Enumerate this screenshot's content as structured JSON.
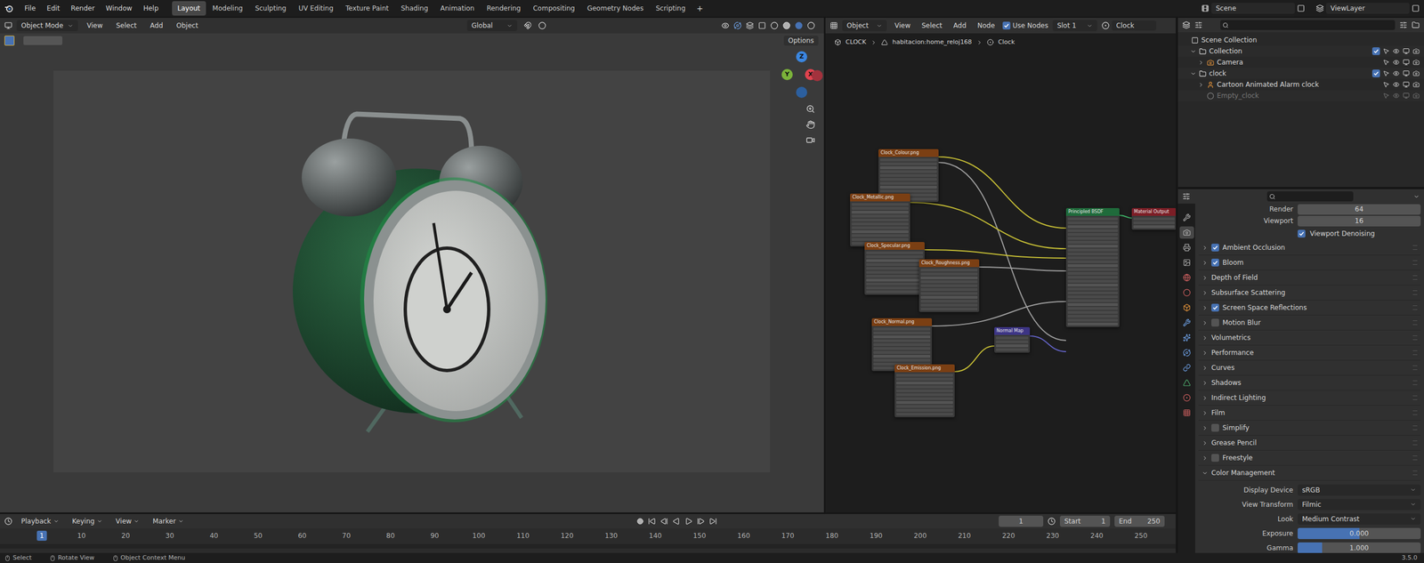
{
  "menu": [
    "File",
    "Edit",
    "Render",
    "Window",
    "Help"
  ],
  "workspaces": [
    {
      "label": "Layout",
      "selected": true
    },
    {
      "label": "Modeling",
      "selected": false
    },
    {
      "label": "Sculpting",
      "selected": false
    },
    {
      "label": "UV Editing",
      "selected": false
    },
    {
      "label": "Texture Paint",
      "selected": false
    },
    {
      "label": "Shading",
      "selected": false
    },
    {
      "label": "Animation",
      "selected": false
    },
    {
      "label": "Rendering",
      "selected": false
    },
    {
      "label": "Compositing",
      "selected": false
    },
    {
      "label": "Geometry Nodes",
      "selected": false
    },
    {
      "label": "Scripting",
      "selected": false
    }
  ],
  "add_workspace": "+",
  "scene": "Scene",
  "view_layer": "ViewLayer",
  "viewport": {
    "mode": "Object Mode",
    "menu": [
      "View",
      "Select",
      "Add",
      "Object"
    ],
    "orientation": "Global",
    "options": "Options",
    "gizmo": [
      {
        "label": "Z",
        "color": "#3b86e0"
      },
      {
        "label": "Y",
        "color": "#7bb33a"
      },
      {
        "label": "X",
        "color": "#e0434f"
      },
      {
        "label": "",
        "color": "#a3323d"
      },
      {
        "label": "",
        "color": "#2c5f9e"
      }
    ]
  },
  "node_editor": {
    "type": "Object",
    "menu": [
      "View",
      "Select",
      "Add",
      "Node"
    ],
    "use_nodes": {
      "label": "Use Nodes",
      "checked": true
    },
    "slot": "Slot 1",
    "material": "Clock",
    "breadcrumb": [
      "CLOCK",
      "habitacion:home_reloj168",
      "Clock"
    ],
    "nodes": [
      {
        "title": "Clock_Colour.png",
        "kind": "image"
      },
      {
        "title": "Clock_Metallic.png",
        "kind": "image"
      },
      {
        "title": "Clock_Specular.png",
        "kind": "image"
      },
      {
        "title": "Clock_Roughness.png",
        "kind": "image"
      },
      {
        "title": "Clock_Normal.png",
        "kind": "image"
      },
      {
        "title": "Clock_Emission.png",
        "kind": "image"
      },
      {
        "title": "Normal Map",
        "kind": "vector"
      },
      {
        "title": "Principled BSDF",
        "kind": "bsdf"
      },
      {
        "title": "Material Output",
        "kind": "output"
      }
    ]
  },
  "outliner": {
    "rows": [
      {
        "label": "Scene Collection",
        "kind": "scene",
        "depth": 0
      },
      {
        "label": "Collection",
        "kind": "collection",
        "depth": 1,
        "expanded": true,
        "checked": true
      },
      {
        "label": "Camera",
        "kind": "camera",
        "depth": 2,
        "expanded": false
      },
      {
        "label": "clock",
        "kind": "collection",
        "depth": 1,
        "expanded": true,
        "checked": true
      },
      {
        "label": "Cartoon Animated  Alarm clock",
        "kind": "armature",
        "depth": 2,
        "expanded": false
      },
      {
        "label": "Empty_clock",
        "kind": "empty",
        "depth": 2,
        "disabled": true
      }
    ]
  },
  "properties": {
    "tabs": [
      {
        "selected": false
      },
      {
        "selected": true
      },
      {
        "selected": false
      },
      {
        "selected": false
      },
      {
        "selected": false
      },
      {
        "selected": false
      },
      {
        "selected": false
      },
      {
        "selected": false
      },
      {
        "selected": false
      },
      {
        "selected": false
      },
      {
        "selected": false
      },
      {
        "selected": false
      },
      {
        "selected": false
      },
      {
        "selected": false
      }
    ],
    "samples": [
      {
        "label": "Render",
        "value": "64"
      },
      {
        "label": "Viewport",
        "value": "16"
      }
    ],
    "denoise": {
      "label": "Viewport Denoising",
      "checked": true
    },
    "panels": [
      {
        "label": "Ambient Occlusion",
        "kind": "toggle",
        "checked": true,
        "expanded": false
      },
      {
        "label": "Bloom",
        "kind": "toggle",
        "checked": true,
        "expanded": false
      },
      {
        "label": "Depth of Field",
        "kind": "plain",
        "expanded": false
      },
      {
        "label": "Subsurface Scattering",
        "kind": "plain",
        "expanded": false
      },
      {
        "label": "Screen Space Reflections",
        "kind": "toggle",
        "checked": true,
        "expanded": false
      },
      {
        "label": "Motion Blur",
        "kind": "toggle",
        "checked": false,
        "expanded": false
      },
      {
        "label": "Volumetrics",
        "kind": "plain",
        "expanded": false
      },
      {
        "label": "Performance",
        "kind": "plain",
        "expanded": false
      },
      {
        "label": "Curves",
        "kind": "plain",
        "expanded": false
      },
      {
        "label": "Shadows",
        "kind": "plain",
        "expanded": false
      },
      {
        "label": "Indirect Lighting",
        "kind": "plain",
        "expanded": false
      },
      {
        "label": "Film",
        "kind": "plain",
        "expanded": false
      },
      {
        "label": "Simplify",
        "kind": "toggle",
        "checked": false,
        "expanded": false
      },
      {
        "label": "Grease Pencil",
        "kind": "plain",
        "expanded": false
      },
      {
        "label": "Freestyle",
        "kind": "toggle",
        "checked": false,
        "expanded": false
      },
      {
        "label": "Color Management",
        "kind": "plain",
        "expanded": true
      }
    ],
    "color_management": [
      {
        "label": "Display Device",
        "value": "sRGB",
        "kind": "dropdown"
      },
      {
        "label": "View Transform",
        "value": "Filmic",
        "kind": "dropdown"
      },
      {
        "label": "Look",
        "value": "Medium Contrast",
        "kind": "dropdown"
      },
      {
        "label": "Exposure",
        "value": "0.000",
        "kind": "slider",
        "level": 0.5
      },
      {
        "label": "Gamma",
        "value": "1.000",
        "kind": "slider",
        "level": 0.2
      }
    ]
  },
  "timeline": {
    "menu": [
      "Playback",
      "Keying",
      "View",
      "Marker"
    ],
    "current_frame": "1",
    "start": {
      "label": "Start",
      "value": "1"
    },
    "end": {
      "label": "End",
      "value": "250"
    },
    "ruler": [
      {
        "label": "1",
        "selected": true
      },
      {
        "label": "10",
        "selected": false
      },
      {
        "label": "20",
        "selected": false
      },
      {
        "label": "30",
        "selected": false
      },
      {
        "label": "40",
        "selected": false
      },
      {
        "label": "50",
        "selected": false
      },
      {
        "label": "60",
        "selected": false
      },
      {
        "label": "70",
        "selected": false
      },
      {
        "label": "80",
        "selected": false
      },
      {
        "label": "90",
        "selected": false
      },
      {
        "label": "100",
        "selected": false
      },
      {
        "label": "110",
        "selected": false
      },
      {
        "label": "120",
        "selected": false
      },
      {
        "label": "130",
        "selected": false
      },
      {
        "label": "140",
        "selected": false
      },
      {
        "label": "150",
        "selected": false
      },
      {
        "label": "160",
        "selected": false
      },
      {
        "label": "170",
        "selected": false
      },
      {
        "label": "180",
        "selected": false
      },
      {
        "label": "190",
        "selected": false
      },
      {
        "label": "200",
        "selected": false
      },
      {
        "label": "210",
        "selected": false
      },
      {
        "label": "220",
        "selected": false
      },
      {
        "label": "230",
        "selected": false
      },
      {
        "label": "240",
        "selected": false
      },
      {
        "label": "250",
        "selected": false
      }
    ]
  },
  "status_bar": {
    "items": [
      "Select",
      "Rotate View",
      "Object Context Menu"
    ],
    "version": "3.5.0"
  }
}
